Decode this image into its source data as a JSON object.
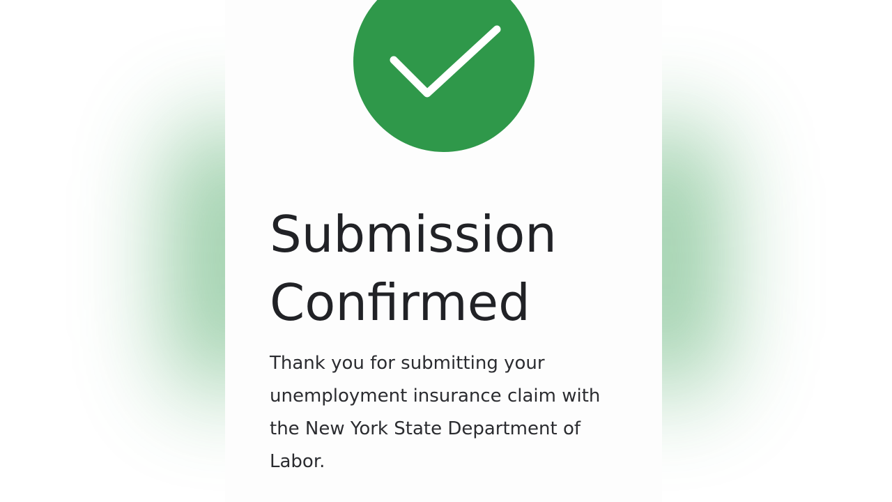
{
  "confirmation": {
    "icon": "checkmark-icon",
    "accent_color": "#2f984a",
    "title_line1": "Submission",
    "title_line2": "Confirmed",
    "message": "Thank you for submitting your unemployment insurance claim with the New York State Department of Labor."
  }
}
